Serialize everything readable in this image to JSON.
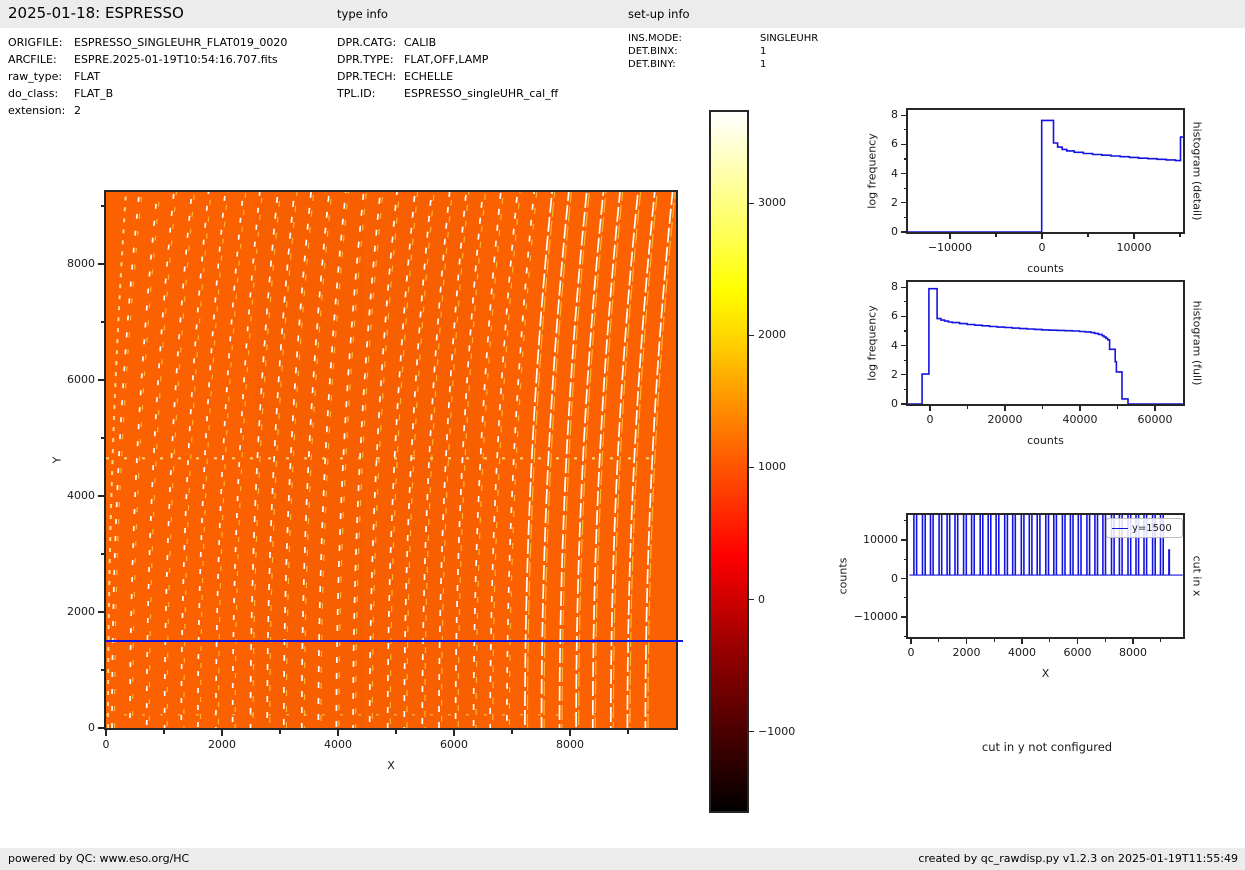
{
  "header": {
    "title": "2025-01-18: ESPRESSO",
    "type_info_label": "type info",
    "setup_info_label": "set-up info"
  },
  "file_info": [
    {
      "label": "ORIGFILE:",
      "value": "ESPRESSO_SINGLEUHR_FLAT019_0020"
    },
    {
      "label": "ARCFILE:",
      "value": "ESPRE.2025-01-19T10:54:16.707.fits"
    },
    {
      "label": "raw_type:",
      "value": "FLAT"
    },
    {
      "label": "do_class:",
      "value": "FLAT_B"
    },
    {
      "label": "extension:",
      "value": "2"
    }
  ],
  "type_info": [
    {
      "label": "DPR.CATG:",
      "value": "CALIB"
    },
    {
      "label": "DPR.TYPE:",
      "value": "FLAT,OFF,LAMP"
    },
    {
      "label": "DPR.TECH:",
      "value": "ECHELLE"
    },
    {
      "label": "TPL.ID:",
      "value": "ESPRESSO_singleUHR_cal_ff"
    }
  ],
  "setup_info": [
    {
      "label": "INS.MODE:",
      "value": "SINGLEUHR"
    },
    {
      "label": "DET.BINX:",
      "value": "1"
    },
    {
      "label": "DET.BINY:",
      "value": "1"
    }
  ],
  "footer": {
    "left": "powered by QC: www.eso.org/HC",
    "right": "created by qc_rawdisp.py v1.2.3 on 2025-01-19T11:55:49"
  },
  "annotations": {
    "cut_in_y": "cut in y not configured"
  },
  "colors": {
    "accent_blue": "#1414e0",
    "image_background": "#fb6100",
    "stripe_white": "#ffffff",
    "stripe_yellow": "#ffbe30",
    "panel_gray": "#ececec",
    "frame": "#262626"
  },
  "chart_data": [
    {
      "id": "raw_image",
      "type": "heatmap",
      "xlabel": "X",
      "ylabel": "Y",
      "x_range": [
        0,
        9828
      ],
      "y_range": [
        0,
        9241
      ],
      "xticks": [
        0,
        2000,
        4000,
        6000,
        8000
      ],
      "xticks_minor": [
        1000,
        3000,
        5000,
        7000,
        9000
      ],
      "yticks": [
        0,
        2000,
        4000,
        6000,
        8000
      ],
      "yticks_minor": [
        1000,
        3000,
        5000,
        7000,
        9000
      ],
      "colormap": "hot",
      "background_counts": 1000,
      "cut_line_y": 1500,
      "stripe_top_shift": 470,
      "order_stripe_x": [
        104,
        414,
        701,
        1011,
        1298,
        1585,
        1895,
        2182,
        2492,
        2779,
        3066,
        3376,
        3663,
        3973,
        4260,
        4547,
        4857,
        5144,
        5454,
        5741,
        6028,
        6338,
        6625,
        6912,
        7222,
        7509,
        7819,
        8106,
        8393,
        8703,
        8990,
        9300
      ],
      "horizontal_features_y": [
        4650,
        230
      ]
    },
    {
      "id": "colorbar",
      "type": "colorbar",
      "ticks": [
        3000,
        2000,
        1000,
        0,
        -1000
      ],
      "range": [
        -1600,
        3690
      ]
    },
    {
      "id": "histogram_detail",
      "type": "line",
      "right_label": "histogram (detail)",
      "xlabel": "counts",
      "ylabel": "log frequency",
      "x_range": [
        -14560,
        15330
      ],
      "y_range": [
        0,
        8.36
      ],
      "xticks_labeled": [
        -10000,
        0,
        10000
      ],
      "xticks_minor": [
        -5000,
        5000,
        15000
      ],
      "yticks": [
        0,
        2,
        4,
        6,
        8
      ],
      "yticks_minor": [
        1,
        3,
        5,
        7
      ],
      "points": [
        [
          -14560,
          0
        ],
        [
          -30,
          0
        ],
        [
          -30,
          7.65
        ],
        [
          1250,
          7.65
        ],
        [
          1250,
          6.1
        ],
        [
          1700,
          6.1
        ],
        [
          1700,
          5.82
        ],
        [
          2200,
          5.82
        ],
        [
          2200,
          5.66
        ],
        [
          2700,
          5.66
        ],
        [
          2700,
          5.56
        ],
        [
          3500,
          5.56
        ],
        [
          3500,
          5.46
        ],
        [
          4500,
          5.46
        ],
        [
          4500,
          5.38
        ],
        [
          5500,
          5.38
        ],
        [
          5500,
          5.31
        ],
        [
          6500,
          5.31
        ],
        [
          6500,
          5.26
        ],
        [
          7500,
          5.26
        ],
        [
          7500,
          5.21
        ],
        [
          8500,
          5.21
        ],
        [
          8500,
          5.16
        ],
        [
          9500,
          5.16
        ],
        [
          9500,
          5.11
        ],
        [
          10500,
          5.11
        ],
        [
          10500,
          5.06
        ],
        [
          11500,
          5.06
        ],
        [
          11500,
          5.02
        ],
        [
          12500,
          5.02
        ],
        [
          12500,
          4.98
        ],
        [
          13500,
          4.98
        ],
        [
          13500,
          4.94
        ],
        [
          14500,
          4.94
        ],
        [
          14500,
          4.89
        ],
        [
          15060,
          4.89
        ],
        [
          15060,
          6.5
        ],
        [
          15330,
          6.5
        ]
      ]
    },
    {
      "id": "histogram_full",
      "type": "line",
      "right_label": "histogram (full)",
      "xlabel": "counts",
      "ylabel": "log frequency",
      "x_range": [
        -5870,
        67470
      ],
      "y_range": [
        0,
        8.36
      ],
      "xticks_labeled": [
        0,
        20000,
        40000,
        60000
      ],
      "xticks_minor": [
        10000,
        30000,
        50000
      ],
      "yticks": [
        0,
        2,
        4,
        6,
        8
      ],
      "yticks_minor": [
        1,
        3,
        5,
        7
      ],
      "points": [
        [
          -5870,
          0
        ],
        [
          -2100,
          0
        ],
        [
          -2100,
          2.05
        ],
        [
          -300,
          2.05
        ],
        [
          -300,
          7.9
        ],
        [
          1900,
          7.9
        ],
        [
          1900,
          5.85
        ],
        [
          2900,
          5.85
        ],
        [
          2900,
          5.75
        ],
        [
          3900,
          5.75
        ],
        [
          3900,
          5.68
        ],
        [
          4900,
          5.68
        ],
        [
          4900,
          5.62
        ],
        [
          5900,
          5.62
        ],
        [
          5900,
          5.58
        ],
        [
          7900,
          5.58
        ],
        [
          7900,
          5.51
        ],
        [
          9900,
          5.51
        ],
        [
          9900,
          5.45
        ],
        [
          11900,
          5.45
        ],
        [
          11900,
          5.4
        ],
        [
          13900,
          5.4
        ],
        [
          13900,
          5.36
        ],
        [
          15900,
          5.36
        ],
        [
          15900,
          5.31
        ],
        [
          17900,
          5.31
        ],
        [
          17900,
          5.27
        ],
        [
          19900,
          5.27
        ],
        [
          19900,
          5.24
        ],
        [
          21900,
          5.24
        ],
        [
          21900,
          5.2
        ],
        [
          23900,
          5.2
        ],
        [
          23900,
          5.17
        ],
        [
          25900,
          5.17
        ],
        [
          25900,
          5.14
        ],
        [
          27900,
          5.14
        ],
        [
          27900,
          5.11
        ],
        [
          29900,
          5.11
        ],
        [
          29900,
          5.08
        ],
        [
          31900,
          5.08
        ],
        [
          31900,
          5.06
        ],
        [
          33900,
          5.06
        ],
        [
          33900,
          5.04
        ],
        [
          35900,
          5.04
        ],
        [
          35900,
          5.02
        ],
        [
          37900,
          5.02
        ],
        [
          37900,
          5.0
        ],
        [
          39900,
          5.0
        ],
        [
          39900,
          4.97
        ],
        [
          41400,
          4.97
        ],
        [
          41400,
          4.94
        ],
        [
          42900,
          4.94
        ],
        [
          42900,
          4.89
        ],
        [
          43900,
          4.89
        ],
        [
          43900,
          4.84
        ],
        [
          44900,
          4.84
        ],
        [
          44900,
          4.77
        ],
        [
          45900,
          4.77
        ],
        [
          45900,
          4.68
        ],
        [
          46400,
          4.68
        ],
        [
          46400,
          4.6
        ],
        [
          46900,
          4.6
        ],
        [
          46900,
          4.5
        ],
        [
          47400,
          4.5
        ],
        [
          47400,
          4.4
        ],
        [
          47900,
          4.4
        ],
        [
          47900,
          3.75
        ],
        [
          49400,
          3.75
        ],
        [
          49400,
          2.9
        ],
        [
          49700,
          2.9
        ],
        [
          49700,
          2.2
        ],
        [
          51200,
          2.2
        ],
        [
          51200,
          0.35
        ],
        [
          52800,
          0.35
        ],
        [
          52800,
          0
        ],
        [
          67400,
          0
        ]
      ]
    },
    {
      "id": "cut_in_x",
      "type": "spikes",
      "right_label": "cut in x",
      "xlabel": "X",
      "ylabel": "counts",
      "legend_label": "y=1500",
      "x_range": [
        -110,
        9800
      ],
      "y_range": [
        -15200,
        16500
      ],
      "xticks_labeled": [
        0,
        2000,
        4000,
        6000,
        8000
      ],
      "xticks_minor": [
        1000,
        3000,
        5000,
        7000,
        9000
      ],
      "yticks_labeled": [
        10000,
        0,
        -10000
      ],
      "yticks_minor": [
        15000,
        5000,
        -5000,
        -15000
      ],
      "baseline_counts": 900,
      "clip_counts": 16500,
      "spike_x": [
        104,
        414,
        701,
        1011,
        1298,
        1585,
        1895,
        2182,
        2492,
        2779,
        3066,
        3376,
        3663,
        3973,
        4260,
        4547,
        4857,
        5144,
        5454,
        5741,
        6028,
        6338,
        6625,
        6912,
        7222,
        7509,
        7819,
        8106,
        8393,
        8703,
        8990
      ],
      "spike_pair_offset": 95,
      "end_spike": {
        "x": 9300,
        "value": 7600
      }
    }
  ]
}
